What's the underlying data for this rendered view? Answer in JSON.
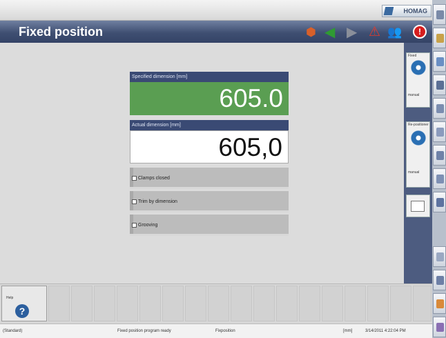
{
  "header": {
    "brand": "HOMAG"
  },
  "title": "Fixed position",
  "dialog": {
    "specified_label": "Specified dimension [mm]",
    "specified_value": "605.0",
    "actual_label": "Actual dimension [mm]",
    "actual_value": "605,0",
    "options": [
      "Clamps closed",
      "Trim by dimension",
      "Grooving"
    ]
  },
  "side_panel": {
    "top_label": "Fixed",
    "top_mode": "manual",
    "bottom_label": "Re-positioner",
    "bottom_mode": "manual"
  },
  "help_label": "Help",
  "status": {
    "mode": "(Standard)",
    "message": "Fixed position program ready",
    "program": "Fixposition",
    "unit": "[mm]",
    "datetime": "3/14/2011 4:22:04 PM"
  },
  "colors": {
    "title_bar": "#3f4f72",
    "specified_bg": "#5a9e52",
    "panel_header": "#3a4a74"
  },
  "icons": [
    "home-icon",
    "back-arrow-icon",
    "forward-arrow-icon",
    "warning-icon",
    "operators-icon",
    "stop-icon",
    "help-icon"
  ]
}
